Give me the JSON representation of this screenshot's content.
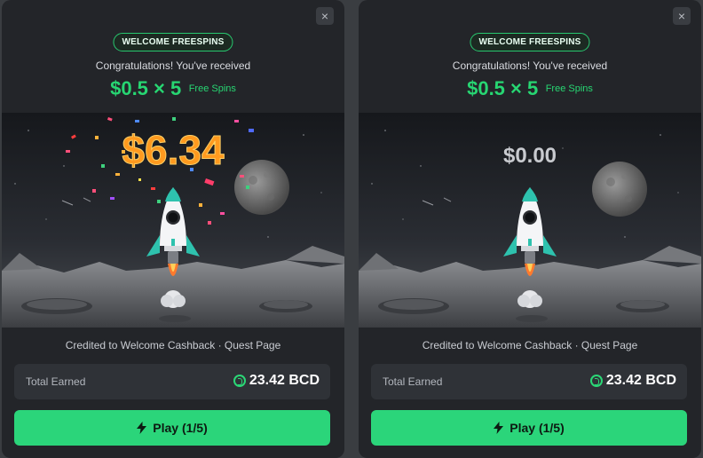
{
  "panels": [
    {
      "id": "left",
      "close_label": "×",
      "badge": "WELCOME FREESPINS",
      "congrats": "Congratulations! You've received",
      "offer_amount": "$0.5 × 5",
      "offer_label": "Free Spins",
      "multiplier": "$6.34",
      "multiplier_color": "#ff9a1f",
      "confetti": true,
      "credited": "Credited to Welcome Cashback · Quest Page",
      "total_label": "Total Earned",
      "total_value": "23.42 BCD",
      "play_label": "Play (1/5)"
    },
    {
      "id": "right",
      "close_label": "×",
      "badge": "WELCOME FREESPINS",
      "congrats": "Congratulations! You've received",
      "offer_amount": "$0.5 × 5",
      "offer_label": "Free Spins",
      "multiplier": "$0.00",
      "multiplier_color": "#c8cacf",
      "confetti": false,
      "credited": "Credited to Welcome Cashback · Quest Page",
      "total_label": "Total Earned",
      "total_value": "23.42 BCD",
      "play_label": "Play (1/5)"
    }
  ],
  "colors": {
    "accent": "#2bd57a",
    "background": "#232529"
  },
  "icons": {
    "close": "close-icon",
    "coin": "bcd-coin-icon",
    "play": "lightning-bolt-icon"
  }
}
